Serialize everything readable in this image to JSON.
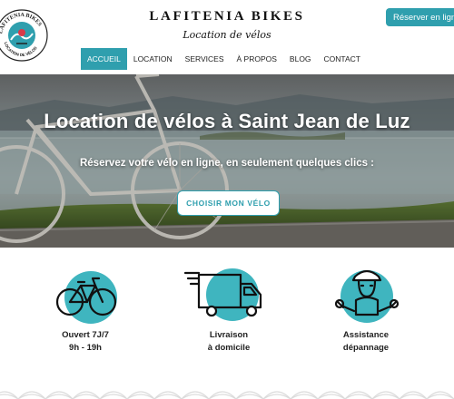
{
  "header": {
    "brand_title": "LAFITENIA BIKES",
    "brand_subtitle": "Location de vélos",
    "logo_text_top": "LAFITENIA BIKES",
    "logo_text_bottom": "LOCATION DE VÉLOS",
    "book_button": "Réserver en ligne"
  },
  "nav": {
    "items": [
      {
        "label": "ACCUEIL",
        "active": true
      },
      {
        "label": "LOCATION",
        "active": false
      },
      {
        "label": "SERVICES",
        "active": false
      },
      {
        "label": "À PROPOS",
        "active": false
      },
      {
        "label": "BLOG",
        "active": false
      },
      {
        "label": "CONTACT",
        "active": false
      }
    ]
  },
  "hero": {
    "title": "Location de vélos à Saint Jean de Luz",
    "subtitle": "Réservez votre vélo en ligne, en seulement quelques clics :",
    "cta": "CHOISIR MON VÉLO"
  },
  "features": [
    {
      "icon": "bicycle-icon",
      "line1": "Ouvert 7J/7",
      "line2": "9h - 19h"
    },
    {
      "icon": "delivery-truck-icon",
      "line1": "Livraison",
      "line2": "à domicile"
    },
    {
      "icon": "mechanic-icon",
      "line1": "Assistance",
      "line2": "dépannage"
    }
  ],
  "colors": {
    "accent": "#2f9fae",
    "icon_circle": "#3fb5bf",
    "text": "#222222"
  }
}
